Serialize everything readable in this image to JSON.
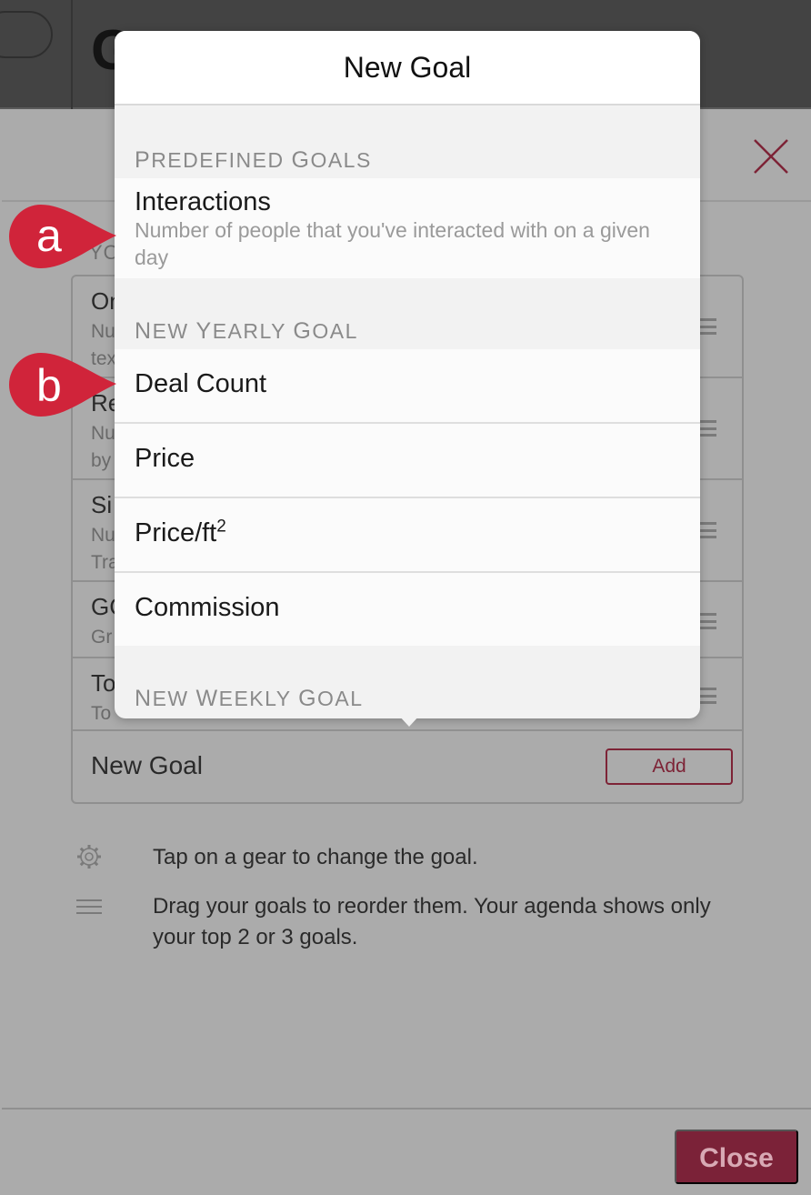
{
  "background": {
    "title_fragment": "Go",
    "section_label_fragment": "YO",
    "goals": [
      {
        "title_fragment": "On",
        "subtitle_lines": [
          "Nu",
          "tex"
        ]
      },
      {
        "title_fragment": "Re",
        "subtitle_lines": [
          "Nu",
          "by"
        ]
      },
      {
        "title_fragment": "Si",
        "subtitle_lines": [
          "Nu",
          "Tra"
        ]
      },
      {
        "title_fragment": "GC",
        "subtitle_lines": [
          "Gr"
        ]
      },
      {
        "title_fragment": "To",
        "subtitle_lines": [
          "To"
        ]
      }
    ],
    "new_goal_label": "New Goal",
    "add_label": "Add",
    "help": [
      {
        "icon": "gear-icon",
        "text": "Tap on a gear to change the goal."
      },
      {
        "icon": "drag-handle-icon",
        "text": "Drag your goals to reorder them. Your agenda shows only your top 2 or 3 goals."
      }
    ],
    "close_label": "Close"
  },
  "popover": {
    "title": "New Goal",
    "sections": [
      {
        "header": "Predefined Goals",
        "items": [
          {
            "label": "Interactions",
            "description": "Number of people that you've interacted with on a given day"
          }
        ]
      },
      {
        "header": "New Yearly Goal",
        "items": [
          {
            "label": "Deal Count"
          },
          {
            "label": "Price"
          },
          {
            "label": "Price/ft",
            "superscript": "2"
          },
          {
            "label": "Commission"
          }
        ]
      },
      {
        "header": "New Weekly Goal",
        "items": []
      }
    ]
  },
  "callouts": [
    {
      "letter": "a"
    },
    {
      "letter": "b"
    }
  ],
  "colors": {
    "accent": "#7b2238",
    "callout": "#d0243a",
    "overlay": "#ababab"
  }
}
